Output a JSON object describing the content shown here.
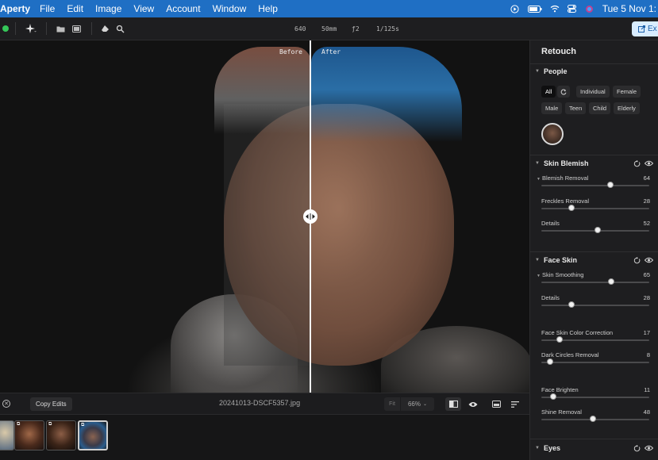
{
  "menubar": {
    "app_name": "Aperty",
    "menus": [
      "File",
      "Edit",
      "Image",
      "View",
      "Account",
      "Window",
      "Help"
    ],
    "date": "Tue 5 Nov  1:"
  },
  "toolbar": {
    "exif": [
      "640",
      "50mm",
      "ƒ2",
      "1/125s"
    ],
    "export_label": "Ex"
  },
  "canvas": {
    "before_label": "Before",
    "after_label": "After"
  },
  "bottombar": {
    "copy_edits_label": "Copy Edits",
    "filename": "20241013-DSCF5357.jpg",
    "fit_label": "Fit",
    "zoom_value": "66%"
  },
  "filmstrip": {
    "count": 4,
    "selected_index": 3
  },
  "panel": {
    "title": "Retouch",
    "people": {
      "title": "People",
      "chips_row1": [
        "All",
        "Individual",
        "Female"
      ],
      "chips_row2": [
        "Male",
        "Teen",
        "Child",
        "Elderly"
      ]
    },
    "skin_blemish": {
      "title": "Skin Blemish",
      "sliders": [
        {
          "label": "Blemish Removal",
          "value": "64",
          "fraction": 0.64
        },
        {
          "label": "Freckles Removal",
          "value": "28",
          "fraction": 0.28
        },
        {
          "label": "Details",
          "value": "52",
          "fraction": 0.52
        }
      ]
    },
    "face_skin": {
      "title": "Face Skin",
      "sliders": [
        {
          "label": "Skin Smoothing",
          "value": "65",
          "fraction": 0.65
        },
        {
          "label": "Details",
          "value": "28",
          "fraction": 0.28
        },
        {
          "label": "Face Skin Color Correction",
          "value": "17",
          "fraction": 0.17
        },
        {
          "label": "Dark Circles Removal",
          "value": "8",
          "fraction": 0.08
        },
        {
          "label": "Face Brighten",
          "value": "11",
          "fraction": 0.11
        },
        {
          "label": "Shine Removal",
          "value": "48",
          "fraction": 0.48
        }
      ]
    },
    "eyes": {
      "title": "Eyes"
    }
  }
}
